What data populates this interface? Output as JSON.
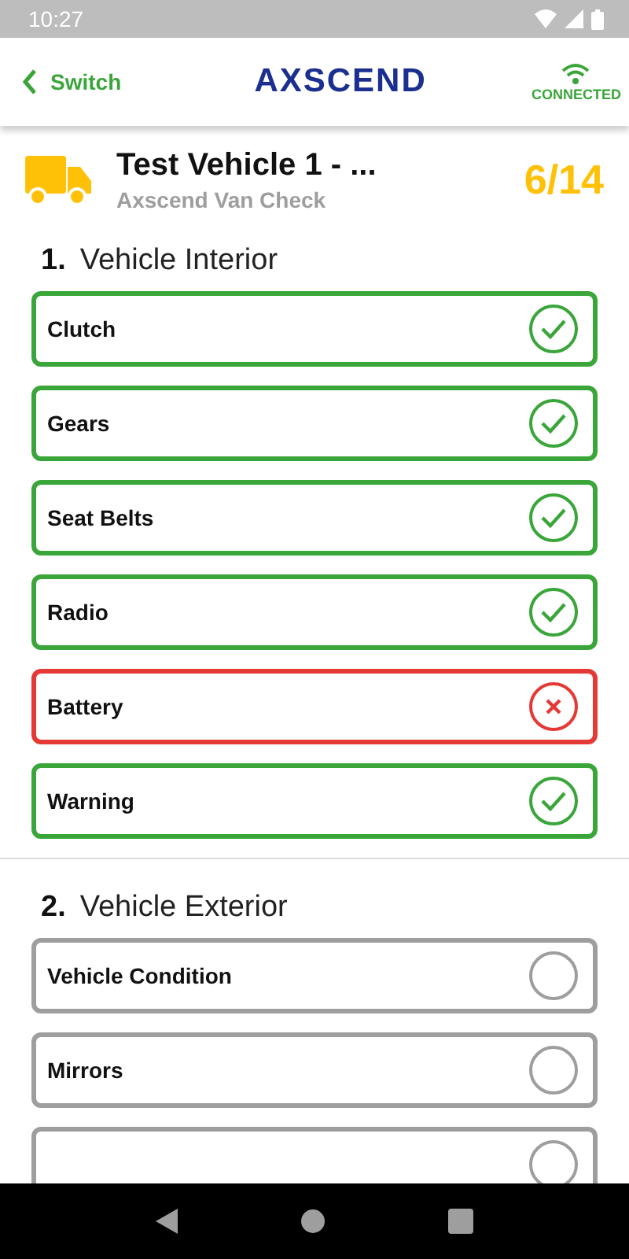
{
  "status_bar": {
    "time": "10:27"
  },
  "header": {
    "back_label": "Switch",
    "logo": "AXSCEND",
    "connection": "CONNECTED"
  },
  "vehicle": {
    "title": "Test Vehicle 1 - ...",
    "subtitle": "Axscend Van Check",
    "progress": "6/14"
  },
  "sections": [
    {
      "number": "1.",
      "title": "Vehicle Interior",
      "items": [
        {
          "label": "Clutch",
          "kind": "pass"
        },
        {
          "label": "Gears",
          "kind": "pass"
        },
        {
          "label": "Seat Belts",
          "kind": "pass"
        },
        {
          "label": "Radio",
          "kind": "pass"
        },
        {
          "label": "Battery",
          "kind": "fail"
        },
        {
          "label": "Warning",
          "kind": "pass"
        }
      ]
    },
    {
      "number": "2.",
      "title": "Vehicle Exterior",
      "items": [
        {
          "label": "Vehicle Condition",
          "kind": "pending"
        },
        {
          "label": "Mirrors",
          "kind": "pending"
        },
        {
          "kind": "pending"
        }
      ]
    }
  ]
}
